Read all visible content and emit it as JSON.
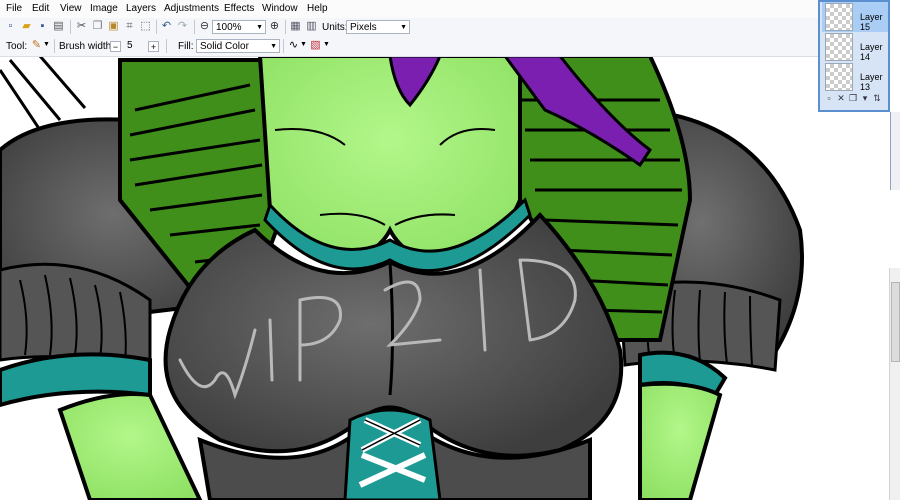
{
  "menu": [
    "File",
    "Edit",
    "View",
    "Image",
    "Layers",
    "Adjustments",
    "Effects",
    "Window",
    "Help"
  ],
  "toolbar": {
    "zoom_value": "100%",
    "units_label": "Units:",
    "units_value": "Pixels",
    "icons": [
      "new-icon",
      "open-icon",
      "save-icon",
      "print-icon",
      "cut-icon",
      "copy-icon",
      "paste-icon",
      "crop-icon",
      "deselect-icon",
      "undo-icon",
      "redo-icon",
      "zoom-out-icon",
      "zoom-in-icon",
      "grid-icon",
      "ruler-icon"
    ]
  },
  "tool_options": {
    "tool_label": "Tool:",
    "brush_width_label": "Brush width:",
    "brush_width_value": "5",
    "fill_label": "Fill:",
    "fill_value": "Solid Color"
  },
  "layers": [
    {
      "name": "Layer 15",
      "selected": true
    },
    {
      "name": "Layer 14",
      "selected": false
    },
    {
      "name": "Layer 13",
      "selected": false
    }
  ],
  "canvas": {
    "watermark": "WIP 2 ID",
    "colors": {
      "skin": "#a4f27a",
      "hair": "#3f8f1a",
      "hair_accent": "#7a1fb0",
      "dress": "#555555",
      "teal": "#1e9a95",
      "outline": "#000000"
    }
  }
}
